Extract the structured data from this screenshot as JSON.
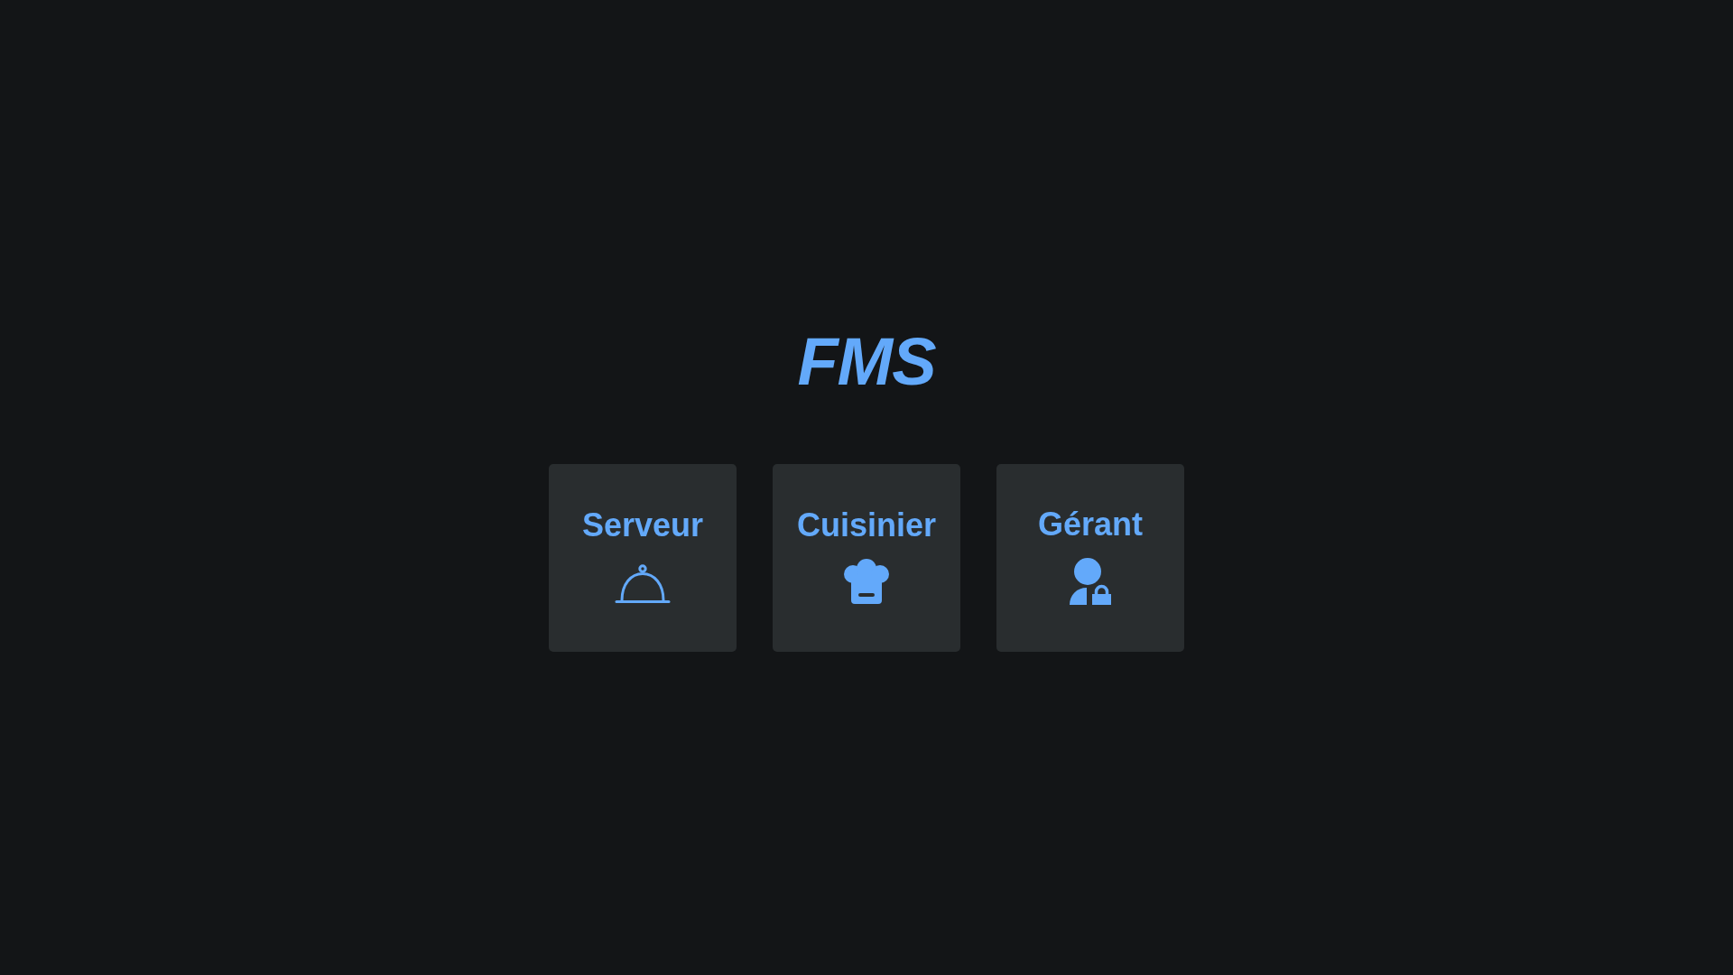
{
  "title": "FMS",
  "roles": [
    {
      "label": "Serveur",
      "kind": "server"
    },
    {
      "label": "Cuisinier",
      "kind": "cook"
    },
    {
      "label": "Gérant",
      "kind": "manager"
    }
  ]
}
